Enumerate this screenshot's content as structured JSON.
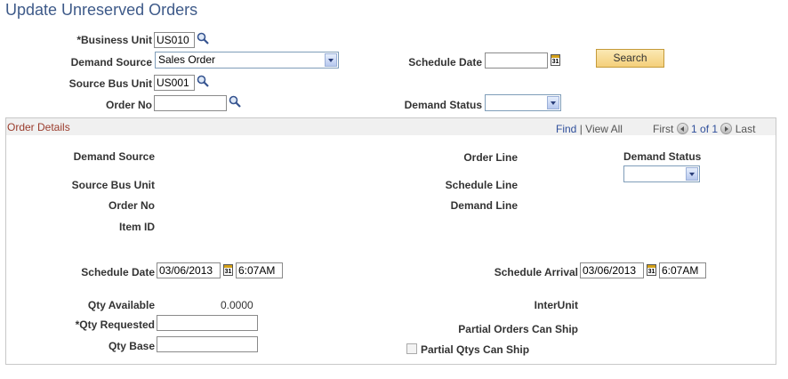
{
  "page": {
    "title": "Update Unreserved Orders"
  },
  "search": {
    "business_unit_label": "*Business Unit",
    "business_unit_value": "US010",
    "demand_source_label": "Demand Source",
    "demand_source_value": "Sales Order",
    "source_bus_unit_label": "Source Bus Unit",
    "source_bus_unit_value": "US001",
    "order_no_label": "Order No",
    "order_no_value": "",
    "schedule_date_label": "Schedule Date",
    "schedule_date_value": "",
    "demand_status_label": "Demand Status",
    "demand_status_value": "",
    "search_button": "Search"
  },
  "details": {
    "section_title": "Order Details",
    "nav": {
      "find": "Find",
      "separator": "|",
      "view_all": "View All",
      "first": "First",
      "position": "1 of 1",
      "last": "Last"
    },
    "demand_source_label": "Demand Source",
    "source_bus_unit_label": "Source Bus Unit",
    "order_no_label": "Order No",
    "item_id_label": "Item ID",
    "order_line_label": "Order Line",
    "schedule_line_label": "Schedule Line",
    "demand_line_label": "Demand Line",
    "demand_status_label": "Demand Status",
    "demand_status_value": "",
    "schedule_date_label": "Schedule Date",
    "schedule_date_value": "03/06/2013",
    "schedule_time_value": "6:07AM",
    "schedule_arrival_label": "Schedule Arrival",
    "schedule_arrival_date_value": "03/06/2013",
    "schedule_arrival_time_value": "6:07AM",
    "qty_available_label": "Qty Available",
    "qty_available_value": "0.0000",
    "qty_requested_label": "*Qty Requested",
    "qty_requested_value": "",
    "qty_base_label": "Qty Base",
    "qty_base_value": "",
    "interunit_label": "InterUnit",
    "partial_orders_label": "Partial Orders Can Ship",
    "partial_qtys_label": "Partial Qtys Can Ship",
    "partial_qtys_checked": false
  },
  "icons": {
    "lookup": "magnifier-icon",
    "calendar": "calendar-icon",
    "dropdown": "chevron-down-icon",
    "prev": "previous-arrow-icon",
    "next": "next-arrow-icon"
  },
  "colors": {
    "title": "#3e5a89",
    "section_title": "#9a3b2b",
    "link": "#2f4f9b",
    "button_top": "#fbe9b4",
    "button_bottom": "#f4cf7a"
  }
}
